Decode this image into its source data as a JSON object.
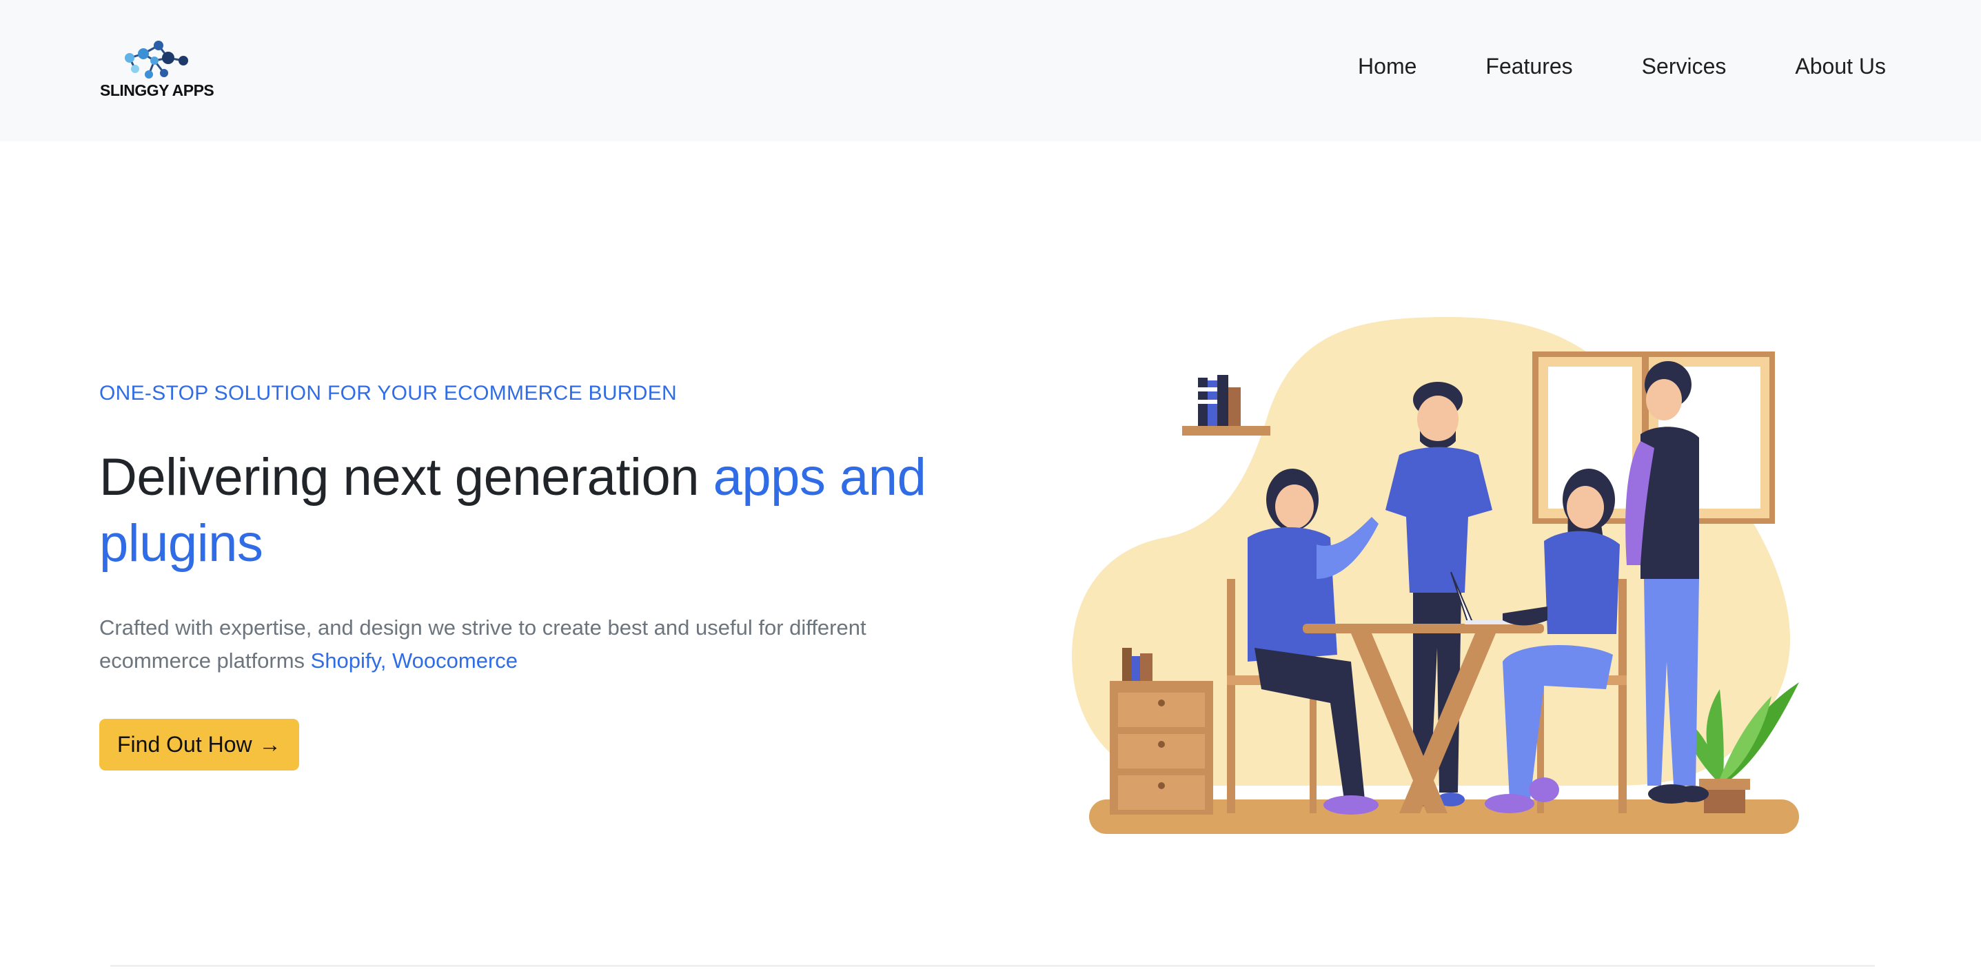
{
  "brand": {
    "name": "SLINGGY APPS",
    "logo_icon": "molecule-dots-logo",
    "colors": {
      "primary": "#2f6ce5",
      "accent_button": "#f7c140",
      "dark_navy": "#1e3a6b"
    }
  },
  "nav": {
    "items": [
      {
        "label": "Home"
      },
      {
        "label": "Features"
      },
      {
        "label": "Services"
      },
      {
        "label": "About Us"
      }
    ]
  },
  "hero": {
    "eyebrow": "ONE-STOP SOLUTION FOR YOUR ECOMMERCE BURDEN",
    "headline_plain": "Delivering next generation ",
    "headline_accent": "apps and plugins",
    "lead_text": "Crafted with expertise, and design we strive to create best and useful for different ecommerce platforms ",
    "lead_links": "Shopify, Woocomerce",
    "cta_label": "Find Out How",
    "cta_arrow": "→",
    "illustration": "team-meeting-illustration"
  }
}
